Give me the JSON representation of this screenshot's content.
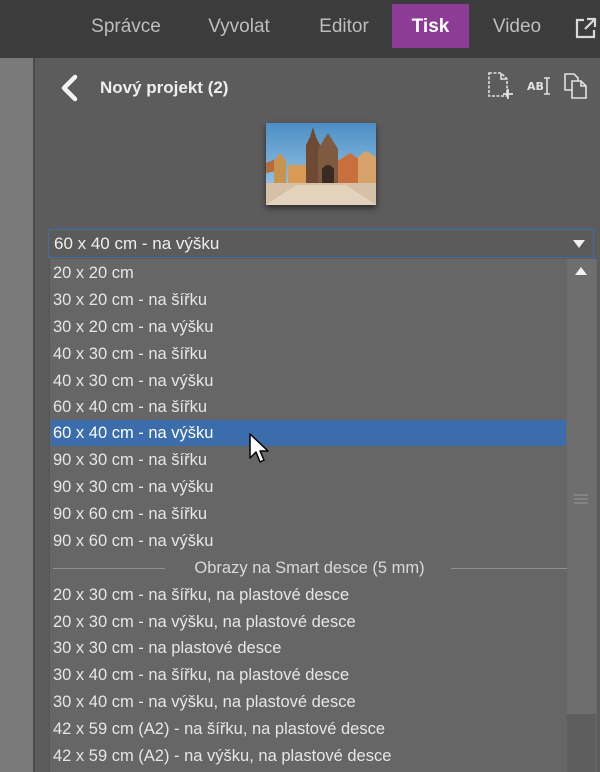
{
  "tabs": [
    {
      "label": "Správce",
      "active": false
    },
    {
      "label": "Vyvolat",
      "active": false
    },
    {
      "label": "Editor",
      "active": false
    },
    {
      "label": "Tisk",
      "active": true
    },
    {
      "label": "Video",
      "active": false
    }
  ],
  "header": {
    "title": "Nový projekt (2)",
    "icons": [
      "back-icon",
      "new-page-icon",
      "rename-icon",
      "duplicate-icon",
      "external-window-icon"
    ]
  },
  "size_select": {
    "value": "60 x 40 cm - na výšku"
  },
  "dropdown": {
    "options": [
      "20 x 20 cm",
      "30 x 20 cm - na šířku",
      "30 x 20 cm - na výšku",
      "40 x 30 cm - na šířku",
      "40 x 30 cm - na výšku",
      "60 x 40 cm - na šířku",
      "60 x 40 cm - na výšku",
      "90 x 30 cm - na šířku",
      "90 x 30 cm - na výšku",
      "90 x 60 cm - na šířku",
      "90 x 60 cm - na výšku"
    ],
    "selected_index": 6,
    "group_header": "Obrazy na Smart desce (5 mm)",
    "group_options": [
      "20 x 30 cm - na šířku, na plastové desce",
      "20 x 30 cm - na výšku, na plastové desce",
      "30 x 30 cm - na plastové desce",
      "30 x 40 cm - na šířku, na plastové desce",
      "30 x 40 cm - na výšku, na plastové desce",
      "42 x 59 cm (A2) - na šířku, na plastové desce",
      "42 x 59 cm (A2) - na výšku, na plastové desce"
    ]
  },
  "colors": {
    "accent_tab": "#8c3c95",
    "selection": "#3b6dad",
    "panel": "#5c5c5c",
    "topbar": "#3c3c3c"
  }
}
